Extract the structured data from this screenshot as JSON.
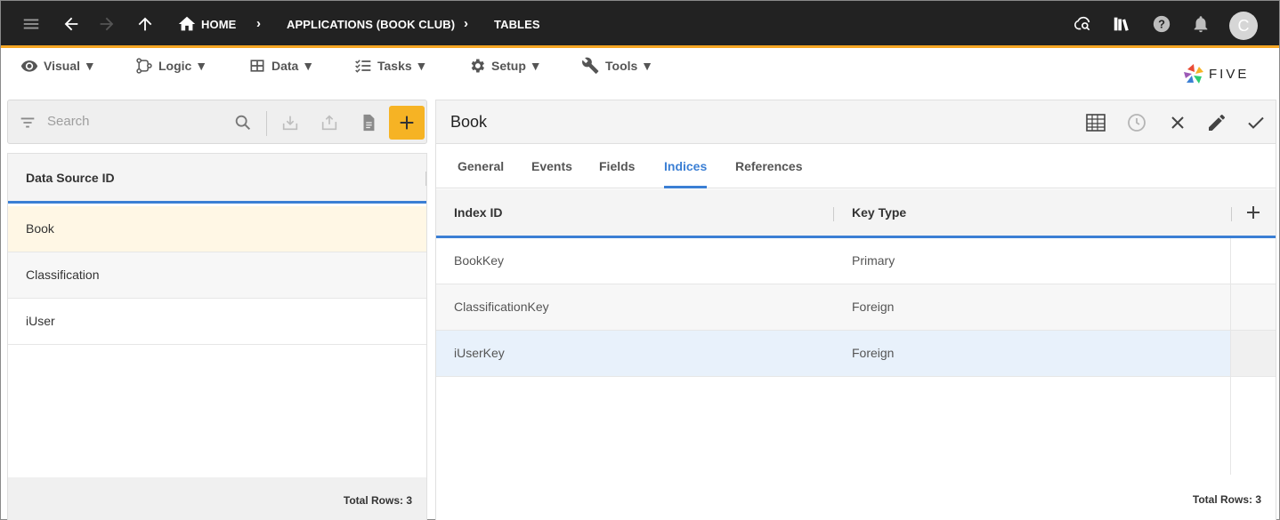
{
  "topbar": {
    "breadcrumbs": [
      "HOME",
      "APPLICATIONS (BOOK CLUB)",
      "TABLES"
    ],
    "avatar_initial": "C",
    "icons": [
      "menu-icon",
      "back-arrow-icon",
      "forward-arrow-icon",
      "up-arrow-icon",
      "home-icon",
      "cloud-search-icon",
      "library-books-icon",
      "help-icon",
      "bell-icon"
    ],
    "accent_color": "#f5a623"
  },
  "menubar": {
    "items": [
      {
        "label": "Visual ▼",
        "icon": "eye-icon"
      },
      {
        "label": "Logic ▼",
        "icon": "logic-flow-icon"
      },
      {
        "label": "Data ▼",
        "icon": "table-icon"
      },
      {
        "label": "Tasks ▼",
        "icon": "checklist-icon"
      },
      {
        "label": "Setup ▼",
        "icon": "gear-icon"
      },
      {
        "label": "Tools ▼",
        "icon": "tools-icon"
      }
    ],
    "logo_text": "FIVE"
  },
  "list": {
    "search_placeholder": "Search",
    "column_header": "Data Source ID",
    "rows": [
      "Book",
      "Classification",
      "iUser"
    ],
    "selected_row": "Book",
    "footer": "Total Rows: 3"
  },
  "form": {
    "title": "Book",
    "tabs": [
      "General",
      "Events",
      "Fields",
      "Indices",
      "References"
    ],
    "active_tab": "Indices",
    "columns": [
      "Index ID",
      "Key Type"
    ],
    "rows": [
      {
        "index_id": "BookKey",
        "key_type": "Primary"
      },
      {
        "index_id": "ClassificationKey",
        "key_type": "Foreign"
      },
      {
        "index_id": "iUserKey",
        "key_type": "Foreign"
      }
    ],
    "footer": "Total Rows: 3",
    "selected_row_color": "#e8f1fb",
    "accent_color": "#3b7fd4"
  }
}
